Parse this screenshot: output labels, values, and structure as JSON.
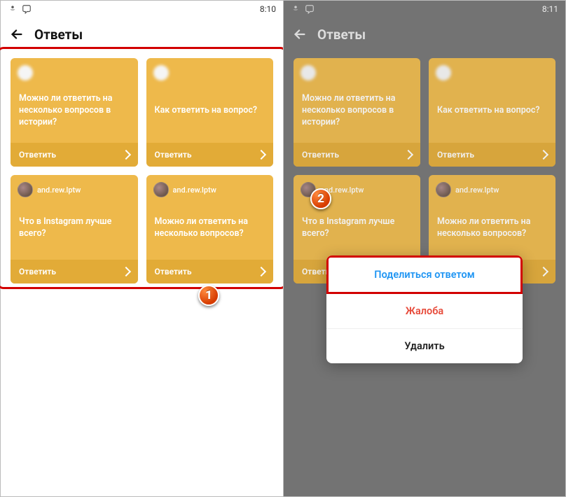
{
  "left": {
    "status_time": "8:10",
    "header": {
      "title": "Ответы"
    },
    "cards": [
      {
        "username": "",
        "question": "Можно ли ответить на несколько вопросов в истории?",
        "answer_label": "Ответить",
        "avatar_type": "blur"
      },
      {
        "username": "",
        "question": "Как ответить на вопрос?",
        "answer_label": "Ответить",
        "avatar_type": "blur"
      },
      {
        "username": "and.rew.lptw",
        "question": "Что в Instagram лучше всего?",
        "answer_label": "Ответить",
        "avatar_type": "img"
      },
      {
        "username": "and.rew.lptw",
        "question": "Можно ли ответить на несколько вопросов?",
        "answer_label": "Ответить",
        "avatar_type": "img"
      }
    ],
    "badge": "1"
  },
  "right": {
    "status_time": "8:11",
    "header": {
      "title": "Ответы"
    },
    "cards": [
      {
        "username": "",
        "question": "Можно ли ответить на несколько вопросов в истории?",
        "answer_label": "Ответить",
        "avatar_type": "blur"
      },
      {
        "username": "",
        "question": "Как ответить на вопрос?",
        "answer_label": "Ответить",
        "avatar_type": "blur"
      },
      {
        "username": "and.rew.lptw",
        "question": "Что в Instagram лучше всего?",
        "answer_label": "Ответить",
        "avatar_type": "img"
      },
      {
        "username": "and.rew.lptw",
        "question": "Можно ли ответить на несколько вопросов?",
        "answer_label": "Ответить",
        "avatar_type": "img"
      }
    ],
    "sheet": {
      "share": "Поделиться ответом",
      "report": "Жалоба",
      "delete": "Удалить"
    },
    "badge": "2"
  }
}
